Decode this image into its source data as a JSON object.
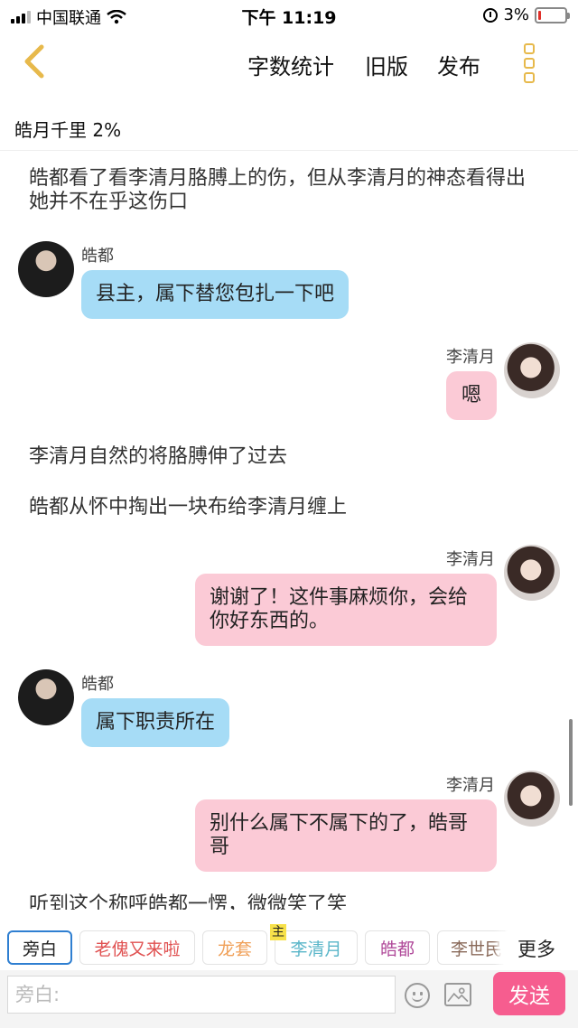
{
  "status_bar": {
    "carrier": "中国联通",
    "time": "下午 11:19",
    "battery": "3%"
  },
  "nav": {
    "word_count": "字数统计",
    "old_version": "旧版",
    "publish": "发布"
  },
  "story": {
    "title_progress": "皓月千里 2%"
  },
  "messages": {
    "n1": "皓都看了看李清月胳膊上的伤，但从李清月的神态看得出她并不在乎这伤口",
    "m1_speaker": "皓都",
    "m1_text": "县主，属下替您包扎一下吧",
    "m2_speaker": "李清月",
    "m2_text": "嗯",
    "n2": "李清月自然的将胳膊伸了过去",
    "n3": "皓都从怀中掏出一块布给李清月缠上",
    "m3_speaker": "李清月",
    "m3_text": "谢谢了！这件事麻烦你，会给你好东西的。",
    "m4_speaker": "皓都",
    "m4_text": "属下职责所在",
    "m5_speaker": "李清月",
    "m5_text": "别什么属下不属下的了，皓哥哥",
    "n4": "听到这个称呼皓都一愣，微微笑了笑"
  },
  "roles": {
    "narrator": "旁白",
    "r1": "老傀又来啦",
    "r2": "龙套",
    "r3": "李清月",
    "r3_badge": "主",
    "r4": "皓都",
    "r5": "李世民",
    "more": "更多"
  },
  "input": {
    "placeholder": "旁白:",
    "send": "发送"
  },
  "colors": {
    "accent_pink": "#f65d8f",
    "bubble_blue": "#a6dcf6",
    "bubble_pink": "#fbcad6",
    "menu_gold": "#e7b94b",
    "active_chip_border": "#2f7fd1"
  }
}
